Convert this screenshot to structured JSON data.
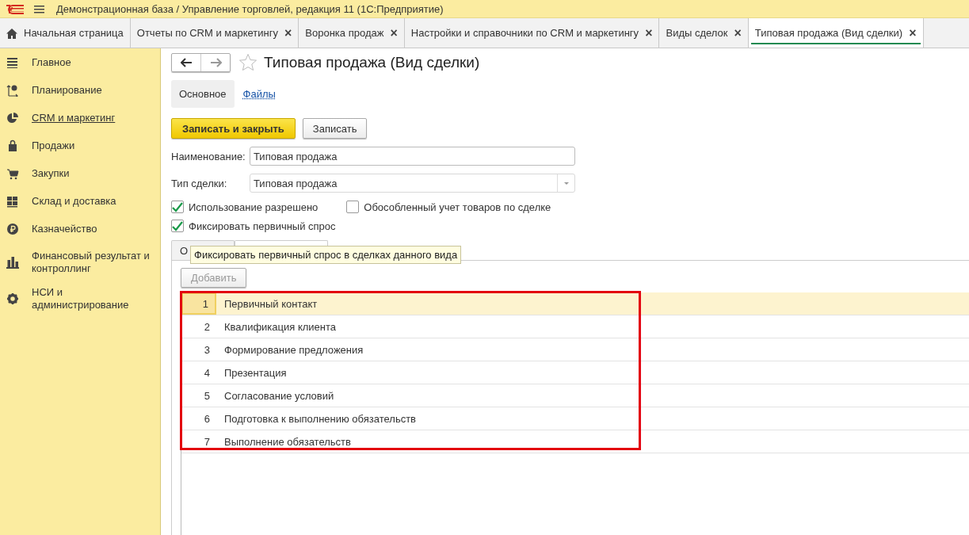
{
  "window": {
    "title": "Демонстрационная база / Управление торговлей, редакция 11  (1С:Предприятие)"
  },
  "tabs": [
    {
      "label": "Начальная страница",
      "kind": "home",
      "selected": false
    },
    {
      "label": "Отчеты по CRM и маркетингу",
      "kind": "closable",
      "selected": false
    },
    {
      "label": "Воронка продаж",
      "kind": "closable",
      "selected": false
    },
    {
      "label": "Настройки и справочники по CRM и маркетингу",
      "kind": "closable",
      "selected": false
    },
    {
      "label": "Виды сделок",
      "kind": "closable",
      "selected": false
    },
    {
      "label": "Типовая продажа (Вид сделки)",
      "kind": "closable",
      "selected": true
    }
  ],
  "close_glyph": "×",
  "sidebar": {
    "items": [
      {
        "label": "Главное",
        "selected": false
      },
      {
        "label": "Планирование",
        "selected": false
      },
      {
        "label": "CRM и маркетинг",
        "selected": true
      },
      {
        "label": "Продажи",
        "selected": false
      },
      {
        "label": "Закупки",
        "selected": false
      },
      {
        "label": "Склад и доставка",
        "selected": false
      },
      {
        "label": "Казначейство",
        "selected": false
      },
      {
        "label": "Финансовый результат и контроллинг",
        "selected": false
      },
      {
        "label": "НСИ и администрирование",
        "selected": false
      }
    ]
  },
  "form": {
    "title": "Типовая продажа (Вид сделки)",
    "favorite": false,
    "sections": [
      {
        "label": "Основное",
        "selected": true
      },
      {
        "label": "Файлы",
        "selected": false
      }
    ],
    "buttons": [
      {
        "label": "Записать и закрыть",
        "kind": "primary"
      },
      {
        "label": "Записать",
        "kind": "normal"
      }
    ],
    "fields": [
      {
        "label": "Наименование:",
        "value": "Типовая продажа",
        "kind": "text"
      },
      {
        "label": "Тип сделки:",
        "value": "Типовая продажа",
        "kind": "select"
      }
    ],
    "checkboxes": [
      {
        "label": "Использование разрешено",
        "checked": true
      },
      {
        "label": "Обособленный учет товаров по сделке",
        "checked": false
      },
      {
        "label": "Фиксировать первичный спрос",
        "checked": true
      }
    ],
    "inner_tabs": [
      {
        "label": "О",
        "selected": true
      },
      {
        "selected": false
      }
    ],
    "tooltip": "Фиксировать первичный спрос в сделках данного вида",
    "add_button": {
      "label": "Добавить",
      "disabled": true
    },
    "table": {
      "rows": [
        {
          "number": "1",
          "stage": "Первичный контакт",
          "selected": true
        },
        {
          "number": "2",
          "stage": "Квалификация клиента",
          "selected": false
        },
        {
          "number": "3",
          "stage": "Формирование предложения",
          "selected": false
        },
        {
          "number": "4",
          "stage": "Презентация",
          "selected": false
        },
        {
          "number": "5",
          "stage": "Согласование условий",
          "selected": false
        },
        {
          "number": "6",
          "stage": "Подготовка к выполнению обязательств",
          "selected": false
        },
        {
          "number": "7",
          "stage": "Выполнение обязательств",
          "selected": false
        }
      ],
      "highlighted": true
    }
  }
}
